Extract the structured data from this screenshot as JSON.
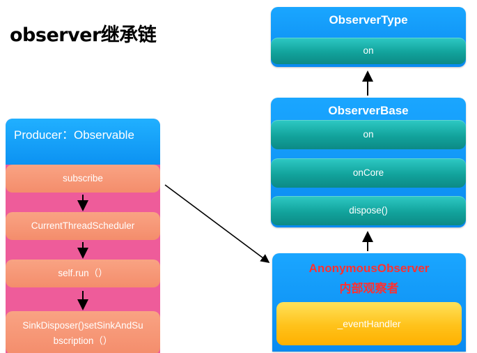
{
  "title": "observer继承链",
  "observer_type": {
    "title": "ObserverType",
    "methods": [
      "on"
    ]
  },
  "observer_base": {
    "title": "ObserverBase",
    "methods": [
      "on",
      "onCore",
      "dispose()"
    ]
  },
  "anonymous_observer": {
    "title": "AnonymousObserver",
    "subtitle": "内部观察者",
    "member": "_eventHandler"
  },
  "producer": {
    "title": "Producer：Observable",
    "steps": [
      "subscribe",
      "CurrentThreadScheduler",
      "self.run（）",
      "SinkDisposer()setSinkAndSu",
      "bscription（）"
    ]
  },
  "colors": {
    "panel_blue": "#0a8af0",
    "bar_teal": "#12a39c",
    "left_pink": "#ee5c9a",
    "step_salmon": "#f48d6c",
    "member_gold": "#ffc21a",
    "highlight_red": "#ff3030"
  }
}
